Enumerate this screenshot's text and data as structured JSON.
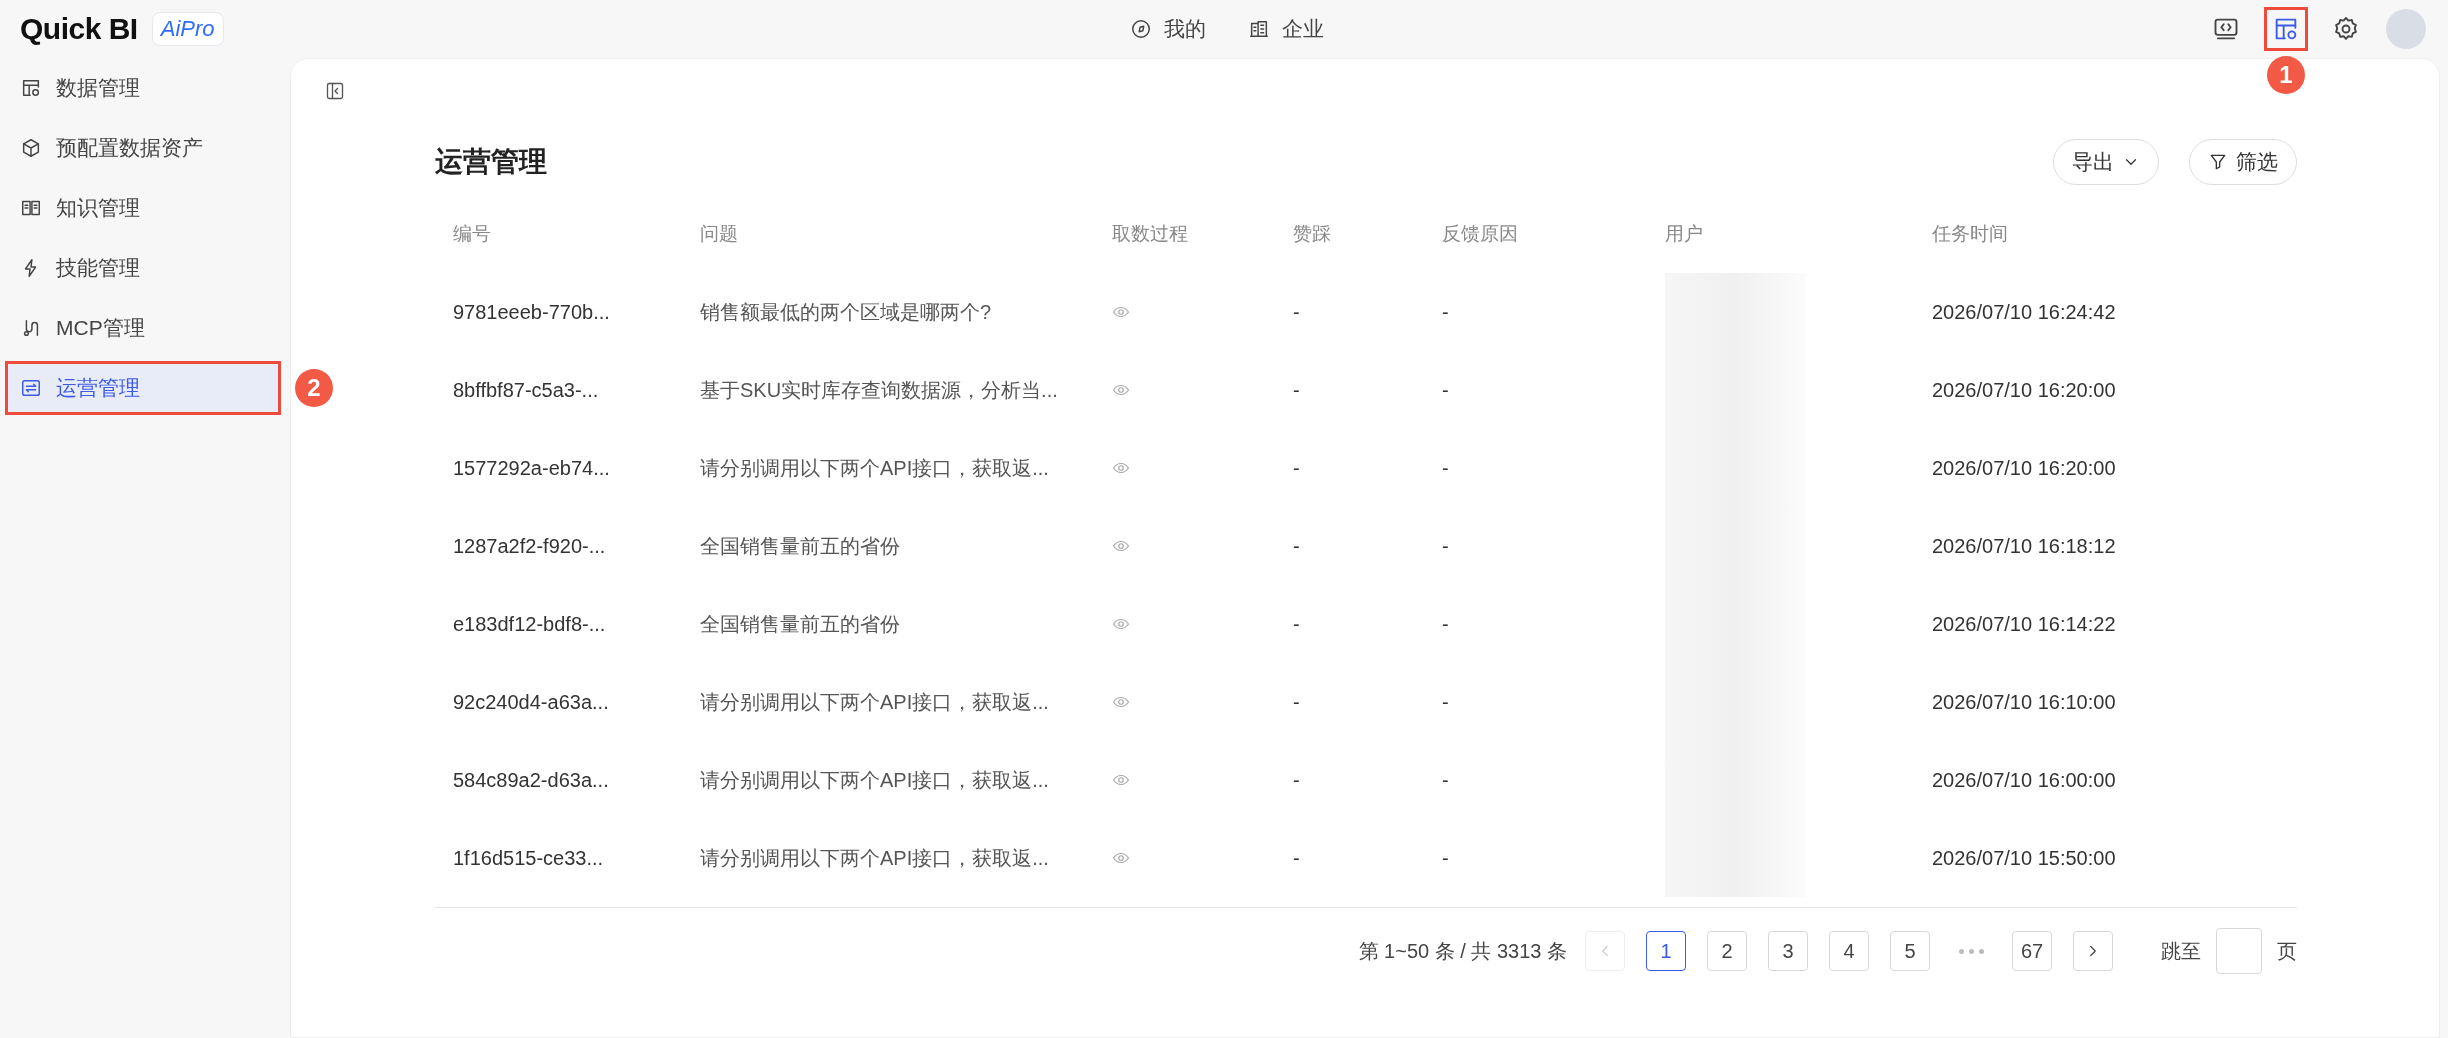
{
  "logo": {
    "name": "Quick BI",
    "badge": "AiPro"
  },
  "top_nav": [
    {
      "kind": "compass",
      "label": "我的"
    },
    {
      "kind": "building",
      "label": "企业"
    }
  ],
  "toolbar": [
    {
      "kind": "code-monitor"
    },
    {
      "kind": "table-gear",
      "callout": "1"
    },
    {
      "kind": "gear"
    },
    {
      "kind": "avatar"
    }
  ],
  "sidebar": {
    "items": [
      {
        "kind": "table-gear",
        "label": "数据管理",
        "selected": false
      },
      {
        "kind": "cube",
        "label": "预配置数据资产",
        "selected": false
      },
      {
        "kind": "book",
        "label": "知识管理",
        "selected": false
      },
      {
        "kind": "bolt",
        "label": "技能管理",
        "selected": false
      },
      {
        "kind": "plug",
        "label": "MCP管理",
        "selected": false
      },
      {
        "kind": "arrows",
        "label": "运营管理",
        "selected": true,
        "callout": "2"
      }
    ]
  },
  "page": {
    "title": "运营管理",
    "buttons": [
      {
        "kind": "dropdown",
        "label": "导出"
      },
      {
        "kind": "filter",
        "label": "筛选"
      }
    ]
  },
  "table": {
    "columns": [
      "编号",
      "问题",
      "取数过程",
      "赞踩",
      "反馈原因",
      "用户",
      "任务时间"
    ],
    "rows": [
      {
        "id": "9781eeeb-770b...",
        "question": "销售额最低的两个区域是哪两个?",
        "vote": "-",
        "reason": "-",
        "time": "2026/07/10 16:24:42"
      },
      {
        "id": "8bffbf87-c5a3-...",
        "question": "基于SKU实时库存查询数据源，分析当...",
        "vote": "-",
        "reason": "-",
        "time": "2026/07/10 16:20:00"
      },
      {
        "id": "1577292a-eb74...",
        "question": "请分别调用以下两个API接口，获取返...",
        "vote": "-",
        "reason": "-",
        "time": "2026/07/10 16:20:00"
      },
      {
        "id": "1287a2f2-f920-...",
        "question": "全国销售量前五的省份",
        "vote": "-",
        "reason": "-",
        "time": "2026/07/10 16:18:12"
      },
      {
        "id": "e183df12-bdf8-...",
        "question": "全国销售量前五的省份",
        "vote": "-",
        "reason": "-",
        "time": "2026/07/10 16:14:22"
      },
      {
        "id": "92c240d4-a63a...",
        "question": "请分别调用以下两个API接口，获取返...",
        "vote": "-",
        "reason": "-",
        "time": "2026/07/10 16:10:00"
      },
      {
        "id": "584c89a2-d63a...",
        "question": "请分别调用以下两个API接口，获取返...",
        "vote": "-",
        "reason": "-",
        "time": "2026/07/10 16:00:00"
      },
      {
        "id": "1f16d515-ce33...",
        "question": "请分别调用以下两个API接口，获取返...",
        "vote": "-",
        "reason": "-",
        "time": "2026/07/10 15:50:00"
      }
    ]
  },
  "pagination": {
    "summary": "第 1~50 条 / 共 3313 条",
    "prev_disabled": true,
    "next_disabled": false,
    "pages": [
      {
        "label": "1",
        "selected": true
      },
      {
        "label": "2",
        "selected": false
      },
      {
        "label": "3",
        "selected": false
      },
      {
        "label": "4",
        "selected": false
      },
      {
        "label": "5",
        "selected": false
      },
      {
        "kind": "ellipsis"
      },
      {
        "label": "67",
        "selected": false
      }
    ],
    "jump_label": "跳至",
    "jump_suffix": "页"
  }
}
